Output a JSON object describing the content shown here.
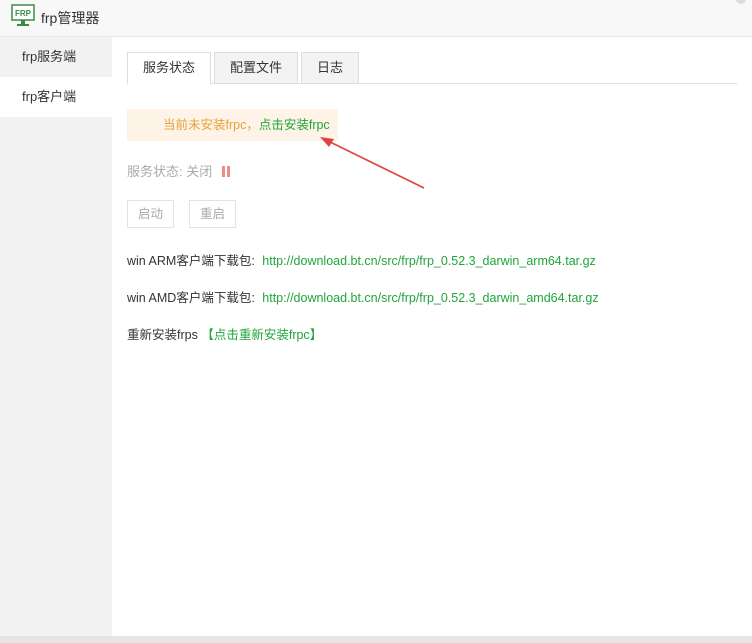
{
  "window": {
    "title": "frp管理器",
    "icon": "frp-monitor-icon",
    "icon_text": "FRP"
  },
  "sidebar": {
    "items": [
      {
        "label": "frp服务端",
        "active": false
      },
      {
        "label": "frp客户端",
        "active": true
      }
    ]
  },
  "tabs": [
    {
      "label": "服务状态",
      "active": true
    },
    {
      "label": "配置文件",
      "active": false
    },
    {
      "label": "日志",
      "active": false
    }
  ],
  "notice": {
    "warning_text": "当前未安装frpc，",
    "install_link": "点击安装frpc"
  },
  "status": {
    "label": "服务状态: 关闭",
    "icon": "pause-icon"
  },
  "buttons": {
    "start": "启动",
    "restart": "重启"
  },
  "downloads": [
    {
      "label": "win ARM客户端下载包:",
      "url": "http://download.bt.cn/src/frp/frp_0.52.3_darwin_arm64.tar.gz"
    },
    {
      "label": "win AMD客户端下载包:",
      "url": "http://download.bt.cn/src/frp/frp_0.52.3_darwin_amd64.tar.gz"
    }
  ],
  "reinstall": {
    "label": "重新安装frps",
    "bracket_open": "【",
    "link": "点击重新安装frpc",
    "bracket_close": "】"
  },
  "colors": {
    "accent_green": "#20a53a",
    "warning_orange": "#e6a23c",
    "annotation_arrow": "#e0443e"
  }
}
